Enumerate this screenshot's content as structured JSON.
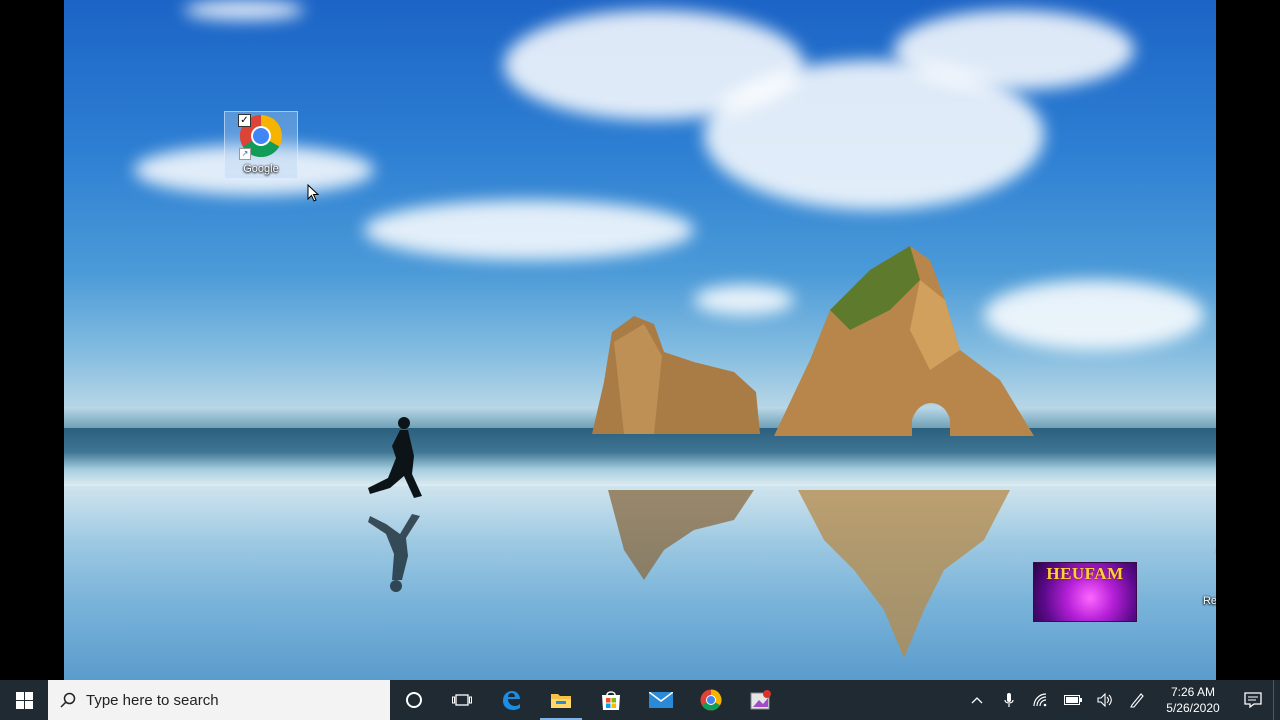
{
  "desktop": {
    "icons": [
      {
        "label": "Google",
        "icon": "chrome-icon",
        "selected": true
      },
      {
        "label": "Recycle Bin",
        "icon": "recycle-bin-icon",
        "selected": false
      }
    ],
    "watermark": "HEUFAM"
  },
  "taskbar": {
    "search_placeholder": "Type here to search",
    "pinned": [
      {
        "name": "cortana-icon"
      },
      {
        "name": "task-view-icon"
      },
      {
        "name": "edge-icon"
      },
      {
        "name": "file-explorer-icon",
        "active": true
      },
      {
        "name": "microsoft-store-icon"
      },
      {
        "name": "mail-icon"
      },
      {
        "name": "chrome-icon"
      },
      {
        "name": "app-icon"
      }
    ],
    "tray": {
      "time": "7:26 AM",
      "date": "5/26/2020"
    }
  },
  "colors": {
    "taskbar": "#1f2a33",
    "accent": "#7eb4ea"
  }
}
